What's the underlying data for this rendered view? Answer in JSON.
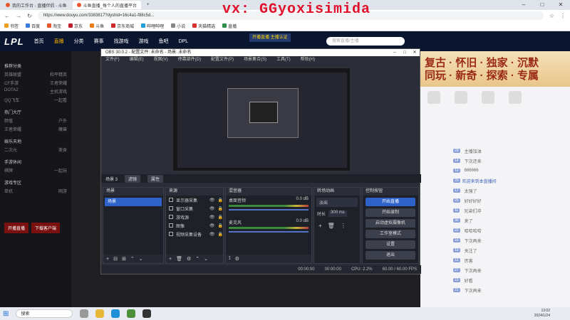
{
  "browser": {
    "tabs": [
      {
        "label": "我的工作台 - 直播伴侣 - 斗鱼"
      },
      {
        "label": "斗鱼直播_每个人的直播平台"
      },
      {
        "label": ""
      }
    ],
    "url": "https://www.douyu.com/3383817?dyshid=16c4a1-f88c5d...",
    "bookmarks": [
      "书签",
      "百度",
      "淘宝",
      "京东",
      "斗鱼",
      "京东商城",
      "哔哩哔哩",
      "小说",
      "天猫精选",
      "直播"
    ]
  },
  "watermark": "vx: GGyoxisimida",
  "site": {
    "logo": "LPL",
    "nav": [
      "首页",
      "直播",
      "分类",
      "赛事",
      "找游戏",
      "游戏",
      "鱼吧",
      "DPL"
    ],
    "live_badge": "开播直播 主播认证",
    "search_placeholder": "搜索直播/主播"
  },
  "sidebar": {
    "sections": [
      {
        "title": "推荐分类",
        "items": [
          [
            "英雄联盟",
            "和平精英"
          ],
          [
            "CF手游",
            "王者荣耀"
          ],
          [
            "DOTA2",
            "主机游戏"
          ],
          [
            "QQ飞车",
            "一起看"
          ]
        ]
      },
      {
        "title": "热门大厅",
        "items": [
          [
            "颜值",
            "户外"
          ],
          [
            "王者荣耀",
            "魔兽"
          ]
        ]
      },
      {
        "title": "娱乐天地",
        "items": [
          [
            "二次元",
            "美食"
          ]
        ]
      },
      {
        "title": "手游休闲",
        "items": [
          [
            "棋牌",
            "一起玩"
          ]
        ]
      },
      {
        "title": "游戏专区",
        "items": [
          [
            "单机",
            "网游"
          ]
        ]
      }
    ],
    "buttons": [
      "开播直播",
      "下载客户端"
    ]
  },
  "banner": {
    "line1": "复古 · 怀旧 · 独家 · 沉默",
    "line2": "同玩 · 新奇 · 探索 · 专属"
  },
  "chat": {
    "messages": [
      {
        "lvl": "29",
        "name": "",
        "text": "主播加油"
      },
      {
        "lvl": "14",
        "name": "",
        "text": "下次还来"
      },
      {
        "lvl": "13",
        "name": "",
        "text": "666666"
      },
      {
        "lvl": "20",
        "name": "欢迎来到本直播间",
        "text": ""
      },
      {
        "lvl": "17",
        "name": "",
        "text": "太强了"
      },
      {
        "lvl": "25",
        "name": "",
        "text": "好好好好"
      },
      {
        "lvl": "11",
        "name": "",
        "text": "兄弟们冲"
      },
      {
        "lvl": "30",
        "name": "",
        "text": "来了"
      },
      {
        "lvl": "22",
        "name": "",
        "text": "哈哈哈哈"
      },
      {
        "lvl": "16",
        "name": "",
        "text": "下次再来"
      },
      {
        "lvl": "19",
        "name": "",
        "text": "关注了"
      },
      {
        "lvl": "12",
        "name": "",
        "text": "厉害"
      },
      {
        "lvl": "27",
        "name": "",
        "text": "下次再来"
      },
      {
        "lvl": "15",
        "name": "",
        "text": "好看"
      },
      {
        "lvl": "21",
        "name": "",
        "text": "下次再来"
      }
    ]
  },
  "obs": {
    "title": "OBS 30.0.2 - 配置文件: 未命名 - 场景: 未命名",
    "menu": [
      "文件(F)",
      "编辑(E)",
      "视图(V)",
      "停靠部件(D)",
      "配置文件(P)",
      "场景集合(S)",
      "工具(T)",
      "帮助(H)"
    ],
    "scene_bar": {
      "scene_name": "场景 3",
      "btn_filters": "滤镜",
      "btn_props": "属性"
    },
    "docks": {
      "scenes": {
        "title": "场景",
        "items": [
          "场景"
        ]
      },
      "sources": {
        "title": "来源",
        "items": [
          "显示器采集",
          "窗口采集",
          "游戏源",
          "图像",
          "视频采集设备"
        ]
      },
      "mixer": {
        "title": "混音器",
        "channels": [
          {
            "name": "桌面音频",
            "db": "0.0 dB"
          },
          {
            "name": "麦克风",
            "db": "0.0 dB"
          }
        ]
      },
      "transitions": {
        "title": "转场动画",
        "type": "淡出",
        "duration_label": "时长",
        "duration": "300 ms"
      },
      "controls": {
        "title": "控制按钮",
        "buttons": [
          "开始直播",
          "开始录制",
          "启动虚拟摄像机",
          "工作室模式",
          "设置",
          "退出"
        ]
      }
    },
    "status": [
      "00:00:00",
      "00:00:00",
      "CPU: 2.2%",
      "60.00 / 60.00 FPS"
    ]
  },
  "taskbar": {
    "search": "搜索",
    "time": "13:02",
    "date": "2024/1/24"
  }
}
